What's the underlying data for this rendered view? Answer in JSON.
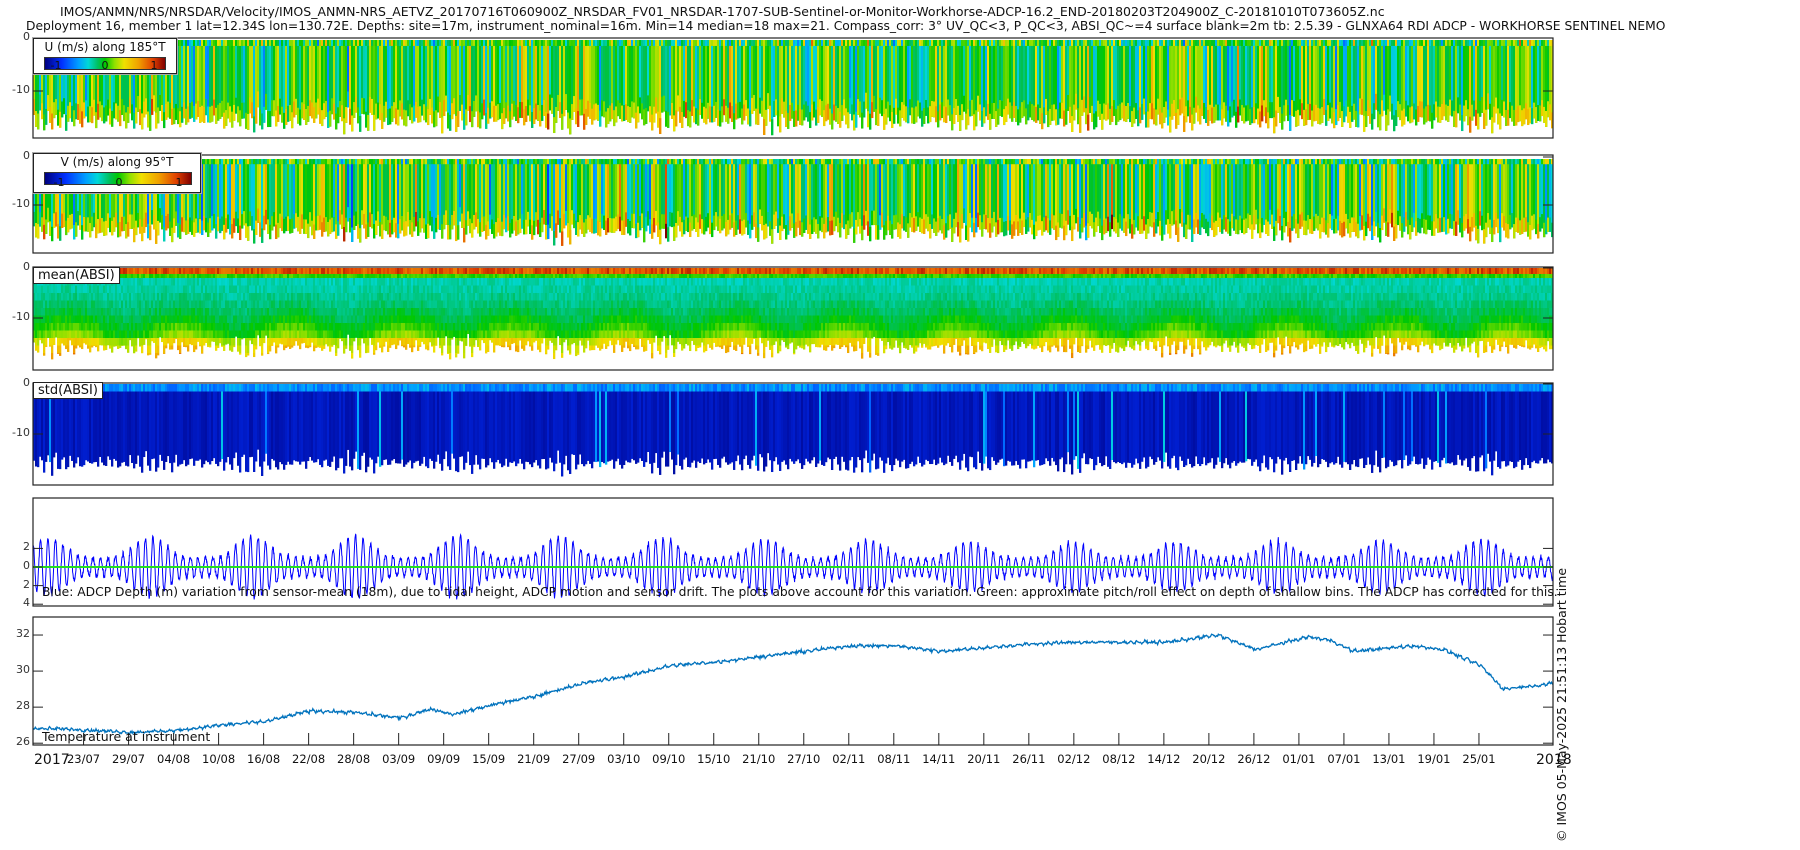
{
  "header": {
    "title": "IMOS/ANMN/NRS/NRSDAR/Velocity/IMOS_ANMN-NRS_AETVZ_20170716T060900Z_NRSDAR_FV01_NRSDAR-1707-SUB-Sentinel-or-Monitor-Workhorse-ADCP-16.2_END-20180203T204900Z_C-20181010T073605Z.nc",
    "subtitle": "Deployment 16, member 1 lat=12.34S lon=130.72E. Depths: site=17m, instrument_nominal=16m. Min=14 median=18 max=21. Compass_corr: 3° UV_QC<3, P_QC<3, ABSI_QC~=4 surface blank=2m tb: 2.5.39 - GLNXA64 RDI ADCP - WORKHORSE SENTINEL NEMO"
  },
  "stamp": "© IMOS 05-May-2025 21:51:13 Hobart time",
  "colors": {
    "depth_line": "#0000ff",
    "pitch_roll_line": "#22dd22",
    "temperature_line": "#0072bd"
  },
  "chart_data": {
    "type": "heatmap",
    "time_range": {
      "start": "2017-07-16T06:09",
      "end": "2018-02-03T20:49",
      "span_days": 202.61
    },
    "x_ticks": {
      "first_tick_offset_days": 6.74,
      "interval_days": 6,
      "labels": [
        "23/07",
        "29/07",
        "04/08",
        "10/08",
        "16/08",
        "22/08",
        "28/08",
        "03/09",
        "09/09",
        "15/09",
        "21/09",
        "27/09",
        "03/10",
        "09/10",
        "15/10",
        "21/10",
        "27/10",
        "02/11",
        "08/11",
        "14/11",
        "20/11",
        "26/11",
        "02/12",
        "08/12",
        "14/12",
        "20/12",
        "26/12",
        "01/01",
        "07/01",
        "13/01",
        "19/01",
        "25/01"
      ],
      "year_start": "2017",
      "year_end": "2018"
    },
    "panels": [
      {
        "id": "u",
        "type": "heatmap",
        "colorbar_title": "U (m/s) along 185°T",
        "colorbar_ticks": [
          "-1",
          "0",
          "1"
        ],
        "clim": [
          -1.25,
          1.25
        ],
        "ylabels": [
          "0",
          "-10"
        ],
        "yticks": [
          0,
          -10
        ],
        "value_sd": 0.28
      },
      {
        "id": "v",
        "type": "heatmap",
        "colorbar_title": "V (m/s) along 95°T",
        "colorbar_ticks": [
          "-1",
          "0",
          "1"
        ],
        "clim": [
          -1.25,
          1.25
        ],
        "ylabels": [
          "0",
          "-10"
        ],
        "yticks": [
          0,
          -10
        ],
        "value_sd": 0.33
      },
      {
        "id": "mean_absi",
        "type": "heatmap",
        "label": "mean(ABSI)",
        "ylabels": [
          "0",
          "-10"
        ],
        "yticks": [
          0,
          -10
        ]
      },
      {
        "id": "std_absi",
        "type": "heatmap",
        "label": "std(ABSI)",
        "ylabels": [
          "0",
          "-10"
        ],
        "yticks": [
          0,
          -10
        ]
      },
      {
        "id": "depth_variation",
        "type": "line",
        "ylabels": [
          "2",
          "0",
          "2",
          "4"
        ],
        "yticks": [
          2,
          0,
          -2,
          -4
        ],
        "ylim": [
          -4.5,
          5
        ],
        "caption": "Blue: ADCP Depth (m) variation from sensor-mean (18m), due to tidal height, ADCP motion and sensor drift. The plots above account for this variation. Green: approximate pitch/roll effect on depth of shallow bins. The ADCP has corrected for this.",
        "tidal_amplitude_range_m": [
          1.0,
          3.4
        ],
        "modulation_period_days": 13.66,
        "tidal_period_days": 1.0
      },
      {
        "id": "temperature",
        "type": "line",
        "label": "Temperature at instrument",
        "ylabels": [
          "32",
          "30",
          "28",
          "26"
        ],
        "yticks": [
          32,
          30,
          28,
          26
        ],
        "ylim": [
          25.9,
          33.0
        ],
        "points": [
          [
            0,
            26.8
          ],
          [
            4,
            26.8
          ],
          [
            13,
            26.6
          ],
          [
            19,
            26.7
          ],
          [
            25,
            27.0
          ],
          [
            31,
            27.2
          ],
          [
            37,
            27.8
          ],
          [
            43,
            27.7
          ],
          [
            49,
            27.4
          ],
          [
            53,
            27.9
          ],
          [
            56,
            27.6
          ],
          [
            62,
            28.2
          ],
          [
            67,
            28.6
          ],
          [
            73,
            29.3
          ],
          [
            79,
            29.7
          ],
          [
            85,
            30.3
          ],
          [
            91,
            30.5
          ],
          [
            97,
            30.8
          ],
          [
            103,
            31.1
          ],
          [
            109,
            31.4
          ],
          [
            115,
            31.4
          ],
          [
            121,
            31.1
          ],
          [
            127,
            31.3
          ],
          [
            133,
            31.5
          ],
          [
            139,
            31.6
          ],
          [
            145,
            31.6
          ],
          [
            151,
            31.6
          ],
          [
            158,
            32.0
          ],
          [
            161,
            31.5
          ],
          [
            163,
            31.2
          ],
          [
            170,
            31.9
          ],
          [
            173,
            31.7
          ],
          [
            176,
            31.1
          ],
          [
            184,
            31.4
          ],
          [
            188,
            31.2
          ],
          [
            193,
            30.3
          ],
          [
            196,
            29.0
          ],
          [
            198,
            29.1
          ],
          [
            202.6,
            29.3
          ]
        ]
      }
    ]
  }
}
